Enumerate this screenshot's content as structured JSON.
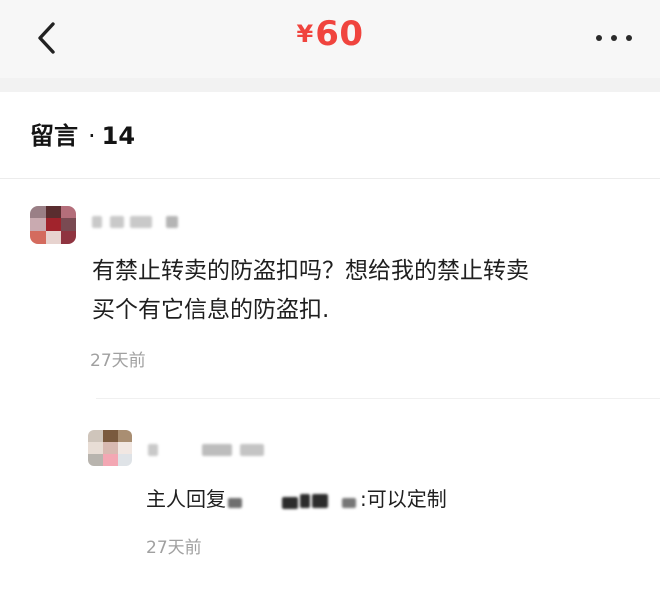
{
  "header": {
    "currency": "¥",
    "price": "60"
  },
  "comments_section": {
    "title": "留言",
    "separator": "·",
    "count": "14"
  },
  "comment": {
    "text_line1": "有禁止转卖的防盗扣吗？想给我的禁止转卖",
    "text_line2": "买个有它信息的防盗扣.",
    "time": "27天前"
  },
  "reply": {
    "prefix": "主人回复",
    "suffix": ":可以定制",
    "time": "27天前"
  },
  "colors": {
    "price_red": "#f0443e",
    "muted_text": "#a0a0a0"
  }
}
